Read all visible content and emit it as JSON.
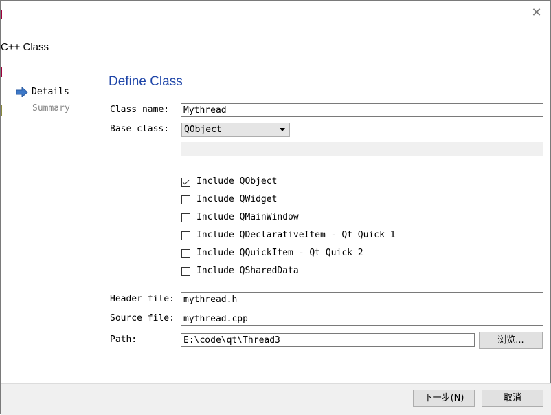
{
  "window": {
    "title": "C++ Class",
    "close_glyph": "✕"
  },
  "sidebar": {
    "steps": [
      {
        "label": "Details",
        "active": true
      },
      {
        "label": "Summary",
        "active": false
      }
    ]
  },
  "page": {
    "heading": "Define Class",
    "class_name": {
      "label": "Class name:",
      "value": "Mythread"
    },
    "base_class": {
      "label": "Base class:",
      "value": "QObject"
    },
    "checkboxes": [
      {
        "label": "Include QObject",
        "checked": true
      },
      {
        "label": "Include QWidget",
        "checked": false
      },
      {
        "label": "Include QMainWindow",
        "checked": false
      },
      {
        "label": "Include QDeclarativeItem - Qt Quick 1",
        "checked": false
      },
      {
        "label": "Include QQuickItem - Qt Quick 2",
        "checked": false
      },
      {
        "label": "Include QSharedData",
        "checked": false
      }
    ],
    "header_file": {
      "label": "Header file:",
      "value": "mythread.h"
    },
    "source_file": {
      "label": "Source file:",
      "value": "mythread.cpp"
    },
    "path": {
      "label": "Path:",
      "value": "E:\\code\\qt\\Thread3",
      "browse_label": "浏览..."
    }
  },
  "footer": {
    "next_label": "下一步(N)",
    "cancel_label": "取消"
  },
  "colors": {
    "heading": "#1e45a8",
    "accent_edge": "#a0003c",
    "arrow": "#3c78c8"
  }
}
